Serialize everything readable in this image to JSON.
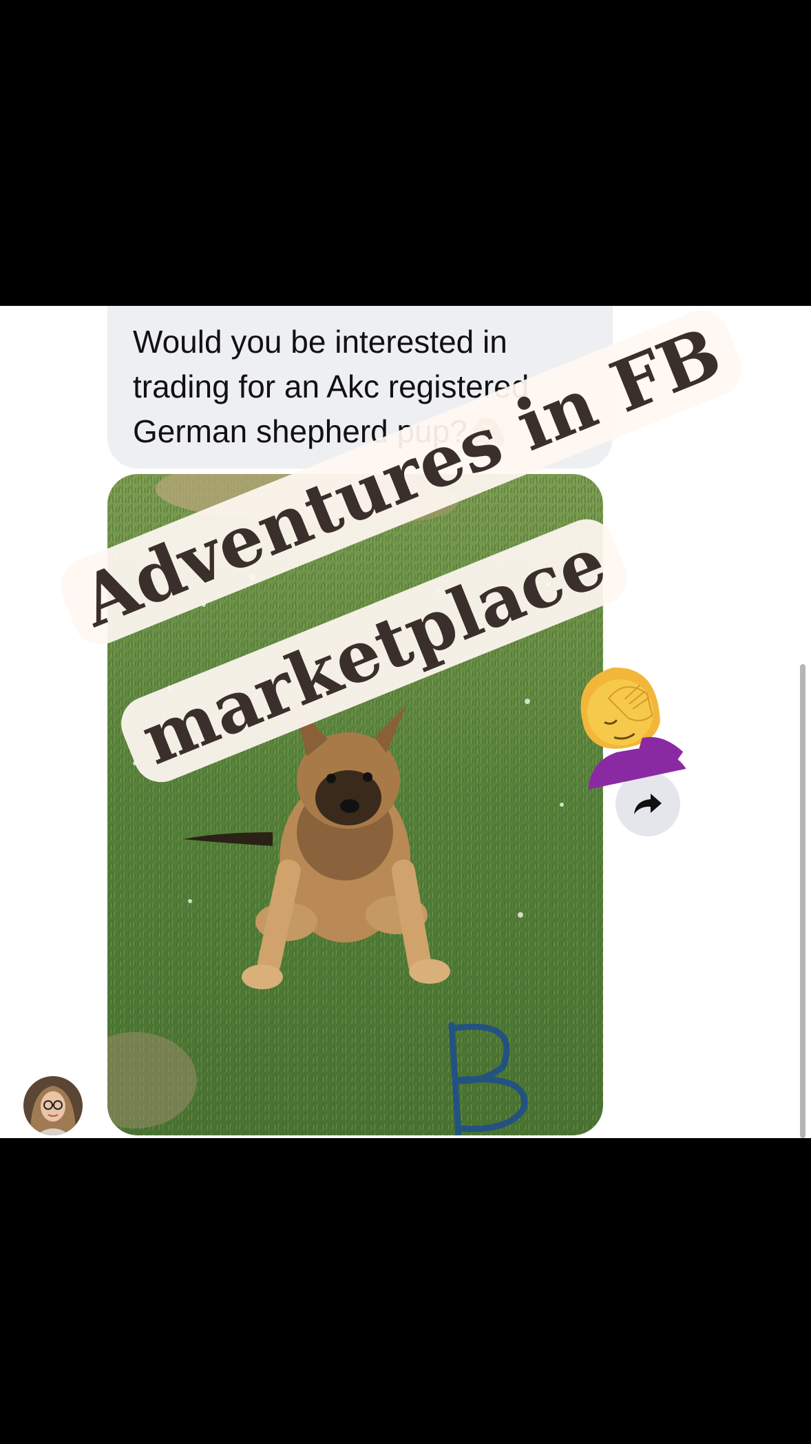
{
  "message": {
    "text": "Would you be interested in trading for an Akc registered German shepherd pup?",
    "line1": "Would you be interested in",
    "line2": "trading for an Akc registered",
    "line3": "German shepherd pup?",
    "emoji": "🙈"
  },
  "photo": {
    "subject": "German shepherd puppy sitting on grass",
    "handwritten_mark": "B"
  },
  "caption": {
    "line1": "Adventures in FB",
    "line2": "marketplace",
    "emoji_icon": "woman-facepalming-icon"
  },
  "colors": {
    "bubble_bg": "#eeeff2",
    "caption_bg": "#fff7f2",
    "caption_text": "#3b2f2c",
    "share_button_bg": "#e4e6eb"
  },
  "icons": {
    "share": "share-arrow-icon",
    "avatar": "user-avatar"
  }
}
